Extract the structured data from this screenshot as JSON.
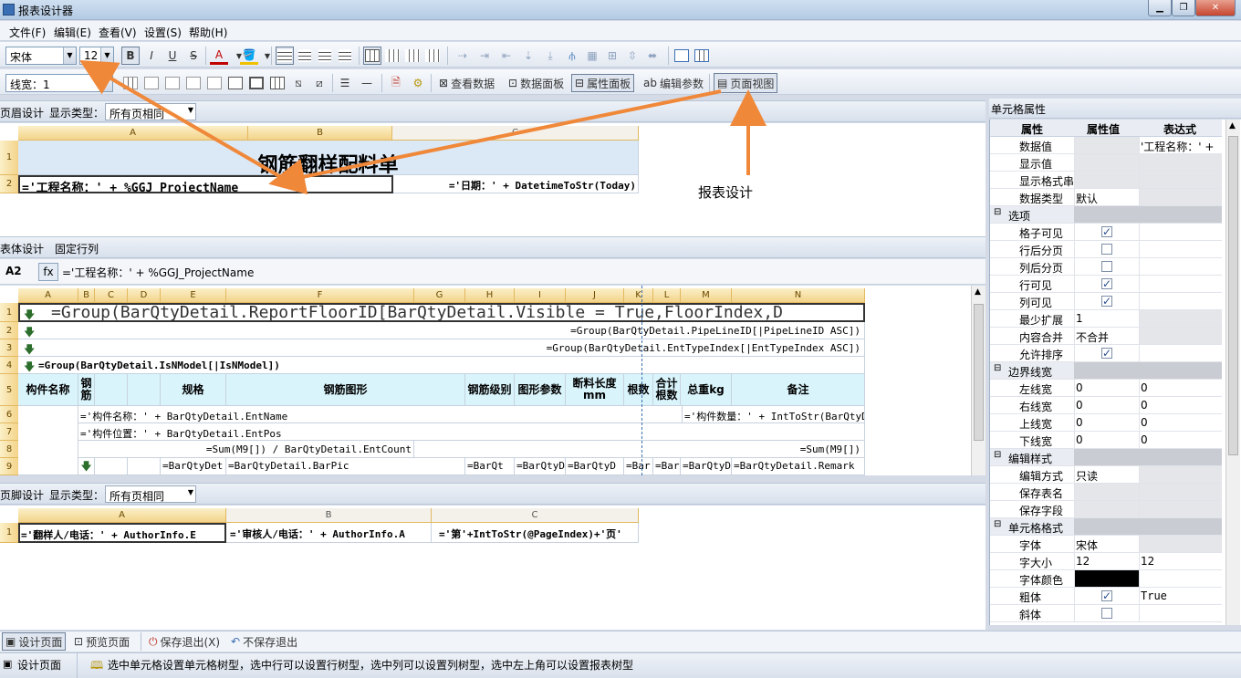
{
  "window": {
    "title": "报表设计器"
  },
  "menu": [
    "文件(F)",
    "编辑(E)",
    "查看(V)",
    "设置(S)",
    "帮助(H)"
  ],
  "toolbar1": {
    "font_name": "宋体",
    "font_size": "12",
    "bold": "B",
    "italic": "I",
    "underline": "U",
    "strike": "S",
    "font_color": "A"
  },
  "toolbar2": {
    "line_width": "线宽：1",
    "view_data": "查看数据",
    "data_panel": "数据面板",
    "prop_panel": "属性面板",
    "edit_params_prefix": "ab",
    "edit_params": "编辑参数",
    "page_view": "页面视图"
  },
  "header_band": {
    "tab": "页眉设计",
    "display_type_label": "显示类型：",
    "display_type": "所有页相同",
    "cols": [
      "A",
      "B",
      "C"
    ],
    "rows": [
      "1",
      "2"
    ],
    "title": "钢筋翻样配料单",
    "a2": "='工程名称：' + %GGJ_ProjectName",
    "c2": "='日期：' + DatetimeToStr(Today)"
  },
  "annotation": {
    "label": "报表设计"
  },
  "body_band": {
    "tab": "表体设计",
    "tab2": "固定行列",
    "cell_ref": "A2",
    "fx": "fx",
    "formula": "='工程名称：' + %GGJ_ProjectName",
    "cols": [
      "A",
      "B",
      "C",
      "D",
      "E",
      "F",
      "G",
      "H",
      "I",
      "J",
      "K",
      "L",
      "M",
      "N"
    ],
    "rows": [
      "1",
      "2",
      "3",
      "4",
      "5",
      "6",
      "7",
      "8",
      "9"
    ],
    "r1": "=Group(BarQtyDetail.ReportFloorID[BarQtyDetail.Visible = True,FloorIndex,D",
    "r2": "=Group(BarQtyDetail.PipeLineID[|PipeLineID ASC])",
    "r3": "=Group(BarQtyDetail.EntTypeIndex[|EntTypeIndex ASC])",
    "r4": "=Group(BarQtyDetail.IsNModel[|IsNModel])",
    "headers": [
      "构件名称",
      "钢筋",
      "规格",
      "钢筋图形",
      "钢筋级别",
      "图形参数",
      "断料长度mm",
      "根数",
      "合计根数",
      "总重kg",
      "备注"
    ],
    "r6a": "='构件名称：' + BarQtyDetail.EntName",
    "r6b": "='构件数量：' + IntToStr(BarQtyD",
    "r7": "='构件位置：' + BarQtyDetail.EntPos",
    "r8a": "=Sum(M9[]) / BarQtyDetail.EntCount",
    "r8b": "=Sum(M9[])",
    "r9": [
      "=BarQtyDet",
      "=BarQtyDetail.BarPic",
      "=BarQt",
      "=BarQtyD",
      "=BarQtyD",
      "=Bar",
      "=Bar",
      "=BarQtyD",
      "=BarQtyDetail.Remark"
    ]
  },
  "footer_band": {
    "tab": "页脚设计",
    "display_type_label": "显示类型：",
    "display_type": "所有页相同",
    "cols": [
      "A",
      "B",
      "C"
    ],
    "rows": [
      "1"
    ],
    "a1": "='翻样人/电话：' + AuthorInfo.E",
    "b1": "='审核人/电话：' + AuthorInfo.A",
    "c1": "='第'+IntToStr(@PageIndex)+'页'"
  },
  "props": {
    "title": "单元格属性",
    "col_prop": "属性",
    "col_val": "属性值",
    "col_expr": "表达式",
    "rows": [
      {
        "type": "item",
        "name": "数据值",
        "val": "",
        "expr": "'工程名称：' +"
      },
      {
        "type": "item",
        "name": "显示值",
        "val": "",
        "expr": ""
      },
      {
        "type": "item",
        "name": "显示格式串",
        "val": "",
        "expr": ""
      },
      {
        "type": "item",
        "name": "数据类型",
        "val": "默认",
        "expr": ""
      },
      {
        "type": "group",
        "name": "选项"
      },
      {
        "type": "check",
        "name": "格子可见",
        "checked": true
      },
      {
        "type": "check",
        "name": "行后分页",
        "checked": false
      },
      {
        "type": "check",
        "name": "列后分页",
        "checked": false
      },
      {
        "type": "check",
        "name": "行可见",
        "checked": true
      },
      {
        "type": "check",
        "name": "列可见",
        "checked": true
      },
      {
        "type": "item",
        "name": "最少扩展",
        "val": "1",
        "expr": ""
      },
      {
        "type": "item",
        "name": "内容合并",
        "val": "不合并",
        "expr": ""
      },
      {
        "type": "check",
        "name": "允许排序",
        "checked": true
      },
      {
        "type": "group",
        "name": "边界线宽"
      },
      {
        "type": "item",
        "name": "左线宽",
        "val": "0",
        "expr": "0"
      },
      {
        "type": "item",
        "name": "右线宽",
        "val": "0",
        "expr": "0"
      },
      {
        "type": "item",
        "name": "上线宽",
        "val": "0",
        "expr": "0"
      },
      {
        "type": "item",
        "name": "下线宽",
        "val": "0",
        "expr": "0"
      },
      {
        "type": "group",
        "name": "编辑样式"
      },
      {
        "type": "item",
        "name": "编辑方式",
        "val": "只读",
        "expr": ""
      },
      {
        "type": "item",
        "name": "保存表名",
        "val": "",
        "expr": ""
      },
      {
        "type": "item",
        "name": "保存字段",
        "val": "",
        "expr": ""
      },
      {
        "type": "group",
        "name": "单元格格式"
      },
      {
        "type": "item",
        "name": "字体",
        "val": "宋体",
        "expr": ""
      },
      {
        "type": "item",
        "name": "字大小",
        "val": "12",
        "expr": "12"
      },
      {
        "type": "color",
        "name": "字体颜色",
        "color": "#000000"
      },
      {
        "type": "check",
        "name": "粗体",
        "checked": true,
        "expr": "True"
      },
      {
        "type": "check",
        "name": "斜体",
        "checked": false
      }
    ]
  },
  "bottom": {
    "design": "设计页面",
    "preview": "预览页面",
    "save_exit": "保存退出(X)",
    "nosave_exit": "不保存退出"
  },
  "status": {
    "mode": "设计页面",
    "hint": "选中单元格设置单元格树型，选中行可以设置行树型，选中列可以设置列树型，选中左上角可以设置报表树型"
  },
  "colors": {
    "arrow": "#f0883a",
    "header_fill": "#f3d38a",
    "table_header": "#d9f4fb"
  }
}
